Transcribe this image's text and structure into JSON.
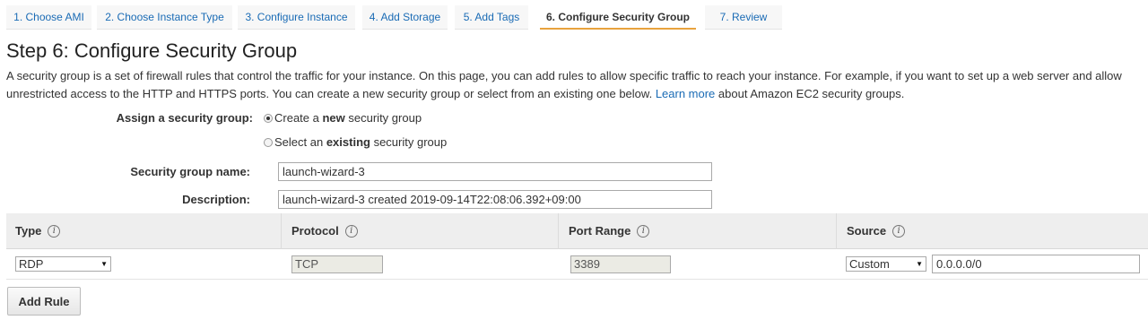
{
  "wizard": {
    "steps": [
      {
        "label": "1. Choose AMI"
      },
      {
        "label": "2. Choose Instance Type"
      },
      {
        "label": "3. Configure Instance"
      },
      {
        "label": "4. Add Storage"
      },
      {
        "label": "5. Add Tags"
      },
      {
        "label": "6. Configure Security Group"
      },
      {
        "label": "7. Review"
      }
    ],
    "active_step": "6. Configure Security Group"
  },
  "page": {
    "title": "Step 6: Configure Security Group",
    "description_line1": "A security group is a set of firewall rules that control the traffic for your instance. On this page, you can add rules to allow specific traffic to reach your instance. For example, if you want to set up a web server and allow",
    "description_line2_before": "unrestricted access to the HTTP and HTTPS ports. You can create a new security group or select from an existing one below.",
    "learn_more": "Learn more",
    "description_line2_after": "about Amazon EC2 security groups."
  },
  "assign": {
    "label": "Assign a security group:",
    "option_create_pre": "Create a ",
    "option_create_bold": "new",
    "option_create_post": " security group",
    "option_existing_pre": "Select an ",
    "option_existing_bold": "existing",
    "option_existing_post": " security group",
    "selected": "new"
  },
  "form": {
    "name_label": "Security group name:",
    "name_value": "launch-wizard-3",
    "description_label": "Description:",
    "description_value": "launch-wizard-3 created 2019-09-14T22:08:06.392+09:00"
  },
  "rules_table": {
    "headers": [
      "Type",
      "Protocol",
      "Port Range",
      "Source"
    ],
    "rows": [
      {
        "type": "RDP",
        "protocol": "TCP",
        "port_range": "3389",
        "source_type": "Custom",
        "source_value": "0.0.0.0/0"
      }
    ]
  },
  "actions": {
    "add_rule": "Add Rule"
  },
  "colors": {
    "link": "#1a6bb5",
    "active_tab_underline": "#e8a33d",
    "header_bg": "#eeeeee"
  },
  "icons": {
    "info": "info-icon",
    "dropdown": "caret-down-icon",
    "radio": "radio-button"
  }
}
